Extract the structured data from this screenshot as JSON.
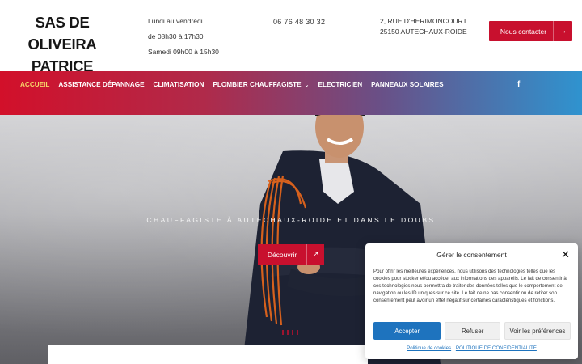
{
  "header": {
    "logo_line1": "SAS DE OLIVEIRA",
    "logo_line2": "PATRICE",
    "hours": [
      "Lundi au vendredi",
      "de 08h30 à 17h30",
      "Samedi 09h00 à 15h30"
    ],
    "phone": "06 76 48 30 32",
    "address_line1": "2, RUE D'HERIMONCOURT",
    "address_line2": "25150 AUTECHAUX-ROIDE",
    "contact_button": "Nous contacter",
    "contact_arrow": "→"
  },
  "nav": {
    "items": [
      {
        "label": "ACCUEIL",
        "active": true
      },
      {
        "label": "ASSISTANCE DÉPANNAGE"
      },
      {
        "label": "CLIMATISATION"
      },
      {
        "label": "PLOMBIER CHAUFFAGISTE",
        "dropdown": true,
        "chevron": "⌄"
      },
      {
        "label": "ELECTRICIEN"
      },
      {
        "label": "PANNEAUX SOLAIRES"
      }
    ],
    "social_icon": "facebook-icon",
    "social_glyph": "f"
  },
  "hero": {
    "tagline": "CHAUFFAGISTE À AUTECHAUX-ROIDE ET DANS LE DOUBS",
    "button": "Découvrir",
    "button_arrow": "↗"
  },
  "consent": {
    "title": "Gérer le consentement",
    "close_glyph": "✕",
    "body": "Pour offrir les meilleures expériences, nous utilisons des technologies telles que les cookies pour stocker et/ou accéder aux informations des appareils. Le fait de consentir à ces technologies nous permettra de traiter des données telles que le comportement de navigation ou les ID uniques sur ce site. Le fait de ne pas consentir ou de retirer son consentement peut avoir un effet négatif sur certaines caractéristiques et fonctions.",
    "accept": "Accepter",
    "refuse": "Refuser",
    "preferences": "Voir les préférences",
    "link_cookies": "Politique de cookies",
    "link_privacy": "POLITIQUE DE CONFIDENTIALITÉ"
  },
  "colors": {
    "brand_red": "#c8102e",
    "nav_gradient_start": "#d2102a",
    "nav_gradient_end": "#2f93cf",
    "accept_blue": "#1e73be"
  }
}
